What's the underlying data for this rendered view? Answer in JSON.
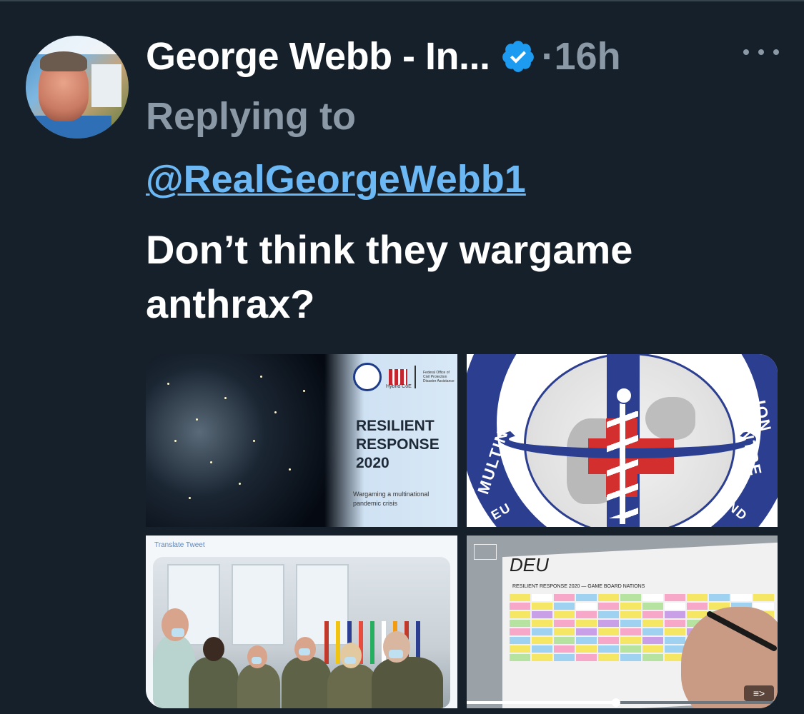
{
  "tweet": {
    "author_name": "George Webb - In...",
    "timestamp": "·16h",
    "reply_label": "Replying to",
    "reply_handle": "@RealGeorgeWebb1",
    "text": "Don’t think they wargame anthrax?",
    "verified": true,
    "more_icon": "ellipsis-icon"
  },
  "media": {
    "tile1": {
      "hybrid_label": "Hybrid CoE",
      "fed_office_text": "Federal Office of Civil Protection Disaster Assistance",
      "title_line1": "RESILIENT",
      "title_line2": "RESPONSE",
      "title_line3": "2020",
      "subtitle_line1": "Wargaming a multinational",
      "subtitle_line2": "pandemic crisis"
    },
    "tile2": {
      "ring_left": "MULTINATIO",
      "ring_right": "ION CENTRE",
      "ring_bottom_left": "EU",
      "ring_bottom_right": "ND"
    },
    "tile3": {
      "translate_label": "Translate Tweet"
    },
    "tile4": {
      "board_title": "DEU",
      "board_subtitle": "RESILIENT RESPONSE 2020 — GAME BOARD NATIONS",
      "expand_label": "≡>",
      "progress": 0.48
    }
  },
  "colors": {
    "background": "#15202b",
    "muted_text": "#8b98a5",
    "link": "#6cb8f5",
    "verified": "#1d9bf0"
  }
}
